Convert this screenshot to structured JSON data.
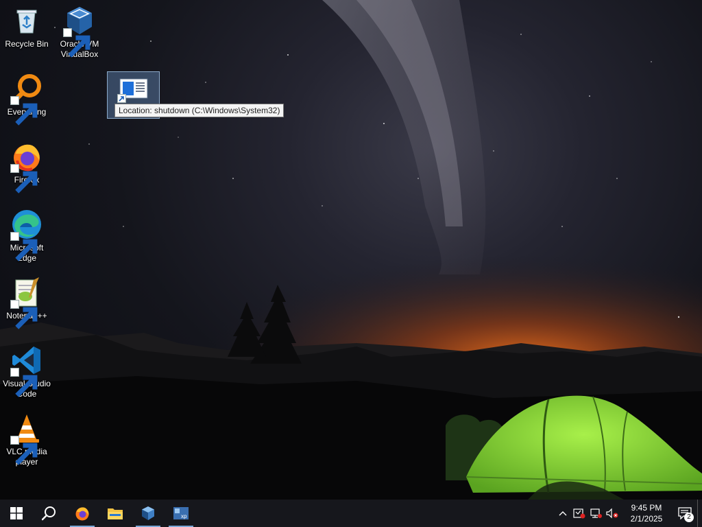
{
  "desktop": {
    "icons": [
      {
        "label": "Recycle Bin",
        "icon": "recycle-bin-icon"
      },
      {
        "label": "Oracle VM\nVirtualBox",
        "icon": "virtualbox-icon"
      },
      {
        "label": "Everything",
        "icon": "everything-search-icon"
      },
      {
        "label": "Firefox",
        "icon": "firefox-icon"
      },
      {
        "label": "Microsoft\nEdge",
        "icon": "edge-icon"
      },
      {
        "label": "Notepad++",
        "icon": "notepadpp-icon"
      },
      {
        "label": "Visual Studio\nCode",
        "icon": "vscode-icon"
      },
      {
        "label": "VLC media\nplayer",
        "icon": "vlc-icon"
      }
    ],
    "selected_shortcut": {
      "icon": "shutdown-shortcut-icon",
      "tooltip": "Location: shutdown (C:\\Windows\\System32)"
    }
  },
  "taskbar": {
    "buttons": [
      {
        "name": "start",
        "icon": "windows-start-icon"
      },
      {
        "name": "search",
        "icon": "search-icon"
      },
      {
        "name": "firefox",
        "icon": "firefox-icon",
        "running": true
      },
      {
        "name": "file-explorer",
        "icon": "folder-icon",
        "running": false
      },
      {
        "name": "virtualbox",
        "icon": "virtualbox-icon",
        "running": true
      },
      {
        "name": "xp-vm",
        "icon": "xp-vm-icon",
        "running": true
      }
    ],
    "tray": {
      "clock_time": "9:45 PM",
      "clock_date": "2/1/2025",
      "notification_count": "2"
    }
  },
  "colors": {
    "taskbar": "#16171c",
    "running_indicator": "#7aa7d6",
    "tent": "#7fd23c",
    "horizon_glow": "#d4621e"
  }
}
